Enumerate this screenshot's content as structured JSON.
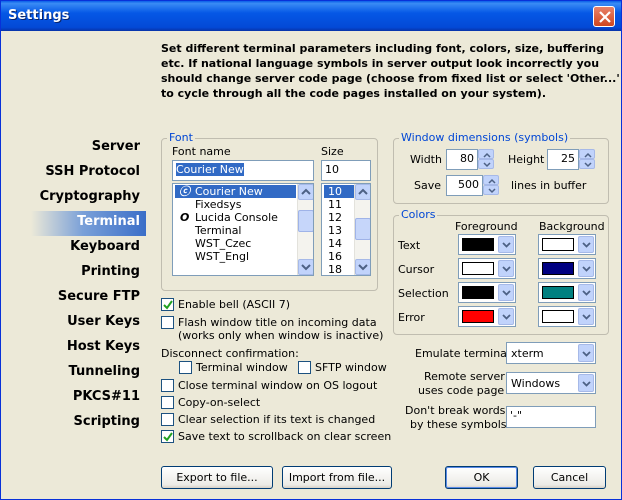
{
  "window": {
    "title": "Settings"
  },
  "intro": "Set different terminal parameters including font, colors, size, buffering etc. If national language symbols in server output look incorrectly you should change server code page (choose from fixed list or select 'Other...' to cycle through all the code pages installed on your system).",
  "sidebar": {
    "items": [
      {
        "label": "Server"
      },
      {
        "label": "SSH Protocol"
      },
      {
        "label": "Cryptography"
      },
      {
        "label": "Terminal",
        "selected": true
      },
      {
        "label": "Keyboard"
      },
      {
        "label": "Printing"
      },
      {
        "label": "Secure FTP"
      },
      {
        "label": "User Keys"
      },
      {
        "label": "Host Keys"
      },
      {
        "label": "Tunneling"
      },
      {
        "label": "PKCS#11"
      },
      {
        "label": "Scripting"
      }
    ]
  },
  "font": {
    "legend": "Font",
    "name_label": "Font name",
    "size_label": "Size",
    "name_value": "Courier New",
    "size_value": "10",
    "fonts": [
      {
        "name": "Courier New",
        "selected": true,
        "icon": "truetype-icon"
      },
      {
        "name": "Fixedsys"
      },
      {
        "name": "Lucida Console",
        "icon": "opentype-icon"
      },
      {
        "name": "Terminal"
      },
      {
        "name": "WST_Czec"
      },
      {
        "name": "WST_Engl"
      }
    ],
    "sizes": [
      {
        "value": "10",
        "selected": true
      },
      {
        "value": "11"
      },
      {
        "value": "12"
      },
      {
        "value": "13"
      },
      {
        "value": "14"
      },
      {
        "value": "16"
      },
      {
        "value": "18"
      }
    ]
  },
  "window_dims": {
    "legend": "Window dimensions (symbols)",
    "width_label": "Width",
    "width_value": "80",
    "height_label": "Height",
    "height_value": "25",
    "save_label": "Save",
    "save_value": "500",
    "save_suffix": "lines in buffer"
  },
  "colors": {
    "legend": "Colors",
    "fg_header": "Foreground",
    "bg_header": "Background",
    "rows": [
      {
        "label": "Text",
        "fg": "#000000",
        "bg": "#ffffff"
      },
      {
        "label": "Cursor",
        "fg": "#ffffff",
        "bg": "#000080"
      },
      {
        "label": "Selection",
        "fg": "#000000",
        "bg": "#008080"
      },
      {
        "label": "Error",
        "fg": "#ff0000",
        "bg": "#ffffff"
      }
    ]
  },
  "options": {
    "enable_bell": {
      "label": "Enable bell (ASCII 7)",
      "checked": true
    },
    "flash_title": {
      "label": "Flash window title on incoming data",
      "label2": "(works only when window is inactive)",
      "checked": false
    },
    "disconnect_label": "Disconnect confirmation:",
    "terminal_window": {
      "label": "Terminal window",
      "checked": false
    },
    "sftp_window": {
      "label": "SFTP window",
      "checked": false
    },
    "close_on_logout": {
      "label": "Close terminal window on OS logout",
      "checked": false
    },
    "copy_on_select": {
      "label": "Copy-on-select",
      "checked": false
    },
    "clear_selection": {
      "label": "Clear selection if its text is changed",
      "checked": false
    },
    "save_scrollback": {
      "label": "Save text to scrollback on clear screen",
      "checked": true
    }
  },
  "emulation": {
    "emulate_label": "Emulate terminal",
    "emulate_value": "xterm",
    "codepage_label1": "Remote server",
    "codepage_label2": "uses code page",
    "codepage_value": "Windows",
    "nobreak_label1": "Don't break words",
    "nobreak_label2": "by these symbols",
    "nobreak_value": "'-\""
  },
  "buttons": {
    "export": "Export to file...",
    "import": "Import from file...",
    "ok": "OK",
    "cancel": "Cancel"
  }
}
